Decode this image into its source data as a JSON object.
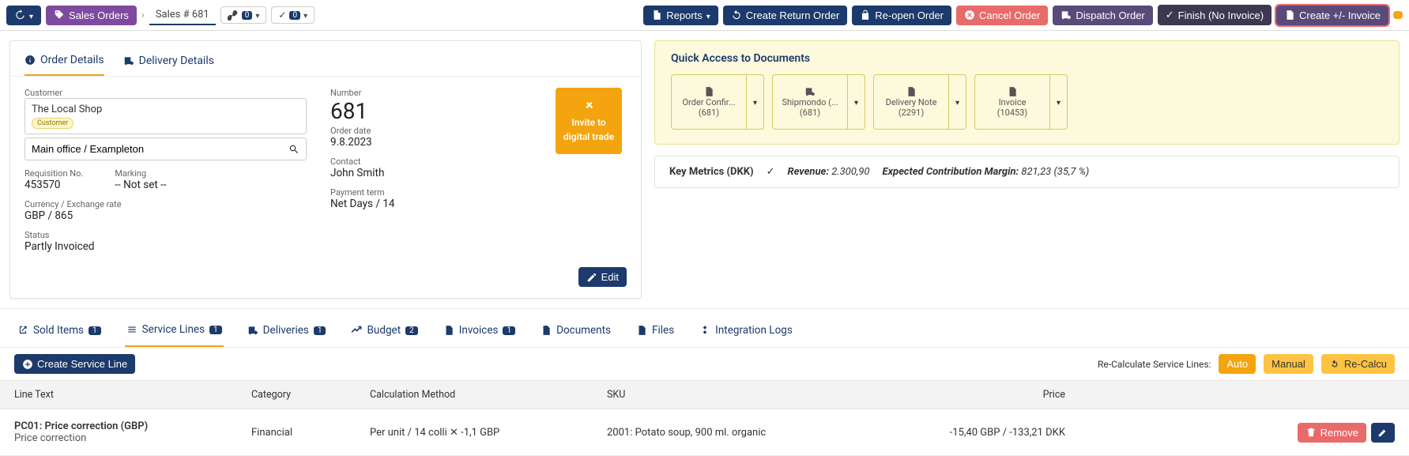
{
  "toolbar": {
    "sales_orders": "Sales Orders",
    "breadcrumb": "Sales # 681",
    "link_count": "0",
    "check_count": "0",
    "reports": "Reports",
    "create_return": "Create Return Order",
    "reopen": "Re-open Order",
    "cancel": "Cancel Order",
    "dispatch": "Dispatch Order",
    "finish": "Finish (No Invoice)",
    "create_invoice": "Create +/- Invoice"
  },
  "card": {
    "tab_order": "Order Details",
    "tab_delivery": "Delivery Details",
    "customer_label": "Customer",
    "customer_name": "The Local Shop",
    "customer_badge": "Customer",
    "location": "Main office / Exampleton",
    "req_label": "Requisition No.",
    "req_value": "453570",
    "marking_label": "Marking",
    "marking_value": "-- Not set --",
    "currency_label": "Currency / Exchange rate",
    "currency_value": "GBP / 865",
    "status_label": "Status",
    "status_value": "Partly Invoiced",
    "number_label": "Number",
    "number_value": "681",
    "orderdate_label": "Order date",
    "orderdate_value": "9.8.2023",
    "contact_label": "Contact",
    "contact_value": "John Smith",
    "payment_label": "Payment term",
    "payment_value": "Net Days / 14",
    "invite_line1": "Invite to",
    "invite_line2": "digital trade",
    "edit": "Edit"
  },
  "quick": {
    "title": "Quick Access to Documents",
    "cards": [
      {
        "label": "Order Confir...",
        "id": "(681)"
      },
      {
        "label": "Shipmondo (...",
        "id": "(681)"
      },
      {
        "label": "Delivery Note",
        "id": "(2291)"
      },
      {
        "label": "Invoice",
        "id": "(10453)"
      }
    ]
  },
  "metrics": {
    "title": "Key Metrics (DKK)",
    "rev_label": "Revenue:",
    "rev_value": "2.300,90",
    "margin_label": "Expected Contribution Margin:",
    "margin_value": "821,23 (35,7 %)"
  },
  "ltabs": {
    "sold": "Sold Items",
    "sold_n": "1",
    "service": "Service Lines",
    "service_n": "1",
    "deliveries": "Deliveries",
    "deliveries_n": "1",
    "budget": "Budget",
    "budget_n": "2",
    "invoices": "Invoices",
    "invoices_n": "1",
    "documents": "Documents",
    "files": "Files",
    "integration": "Integration Logs"
  },
  "actions": {
    "create_line": "Create Service Line",
    "recalc_label": "Re-Calculate Service Lines:",
    "auto": "Auto",
    "manual": "Manual",
    "recalc": "Re-Calcu"
  },
  "table": {
    "h_line": "Line Text",
    "h_cat": "Category",
    "h_calc": "Calculation Method",
    "h_sku": "SKU",
    "h_price": "Price",
    "row": {
      "title": "PC01: Price correction (GBP)",
      "sub": "Price correction",
      "cat": "Financial",
      "calc": "Per unit / 14 colli ✕ -1,1 GBP",
      "sku": "2001: Potato soup, 900 ml. organic",
      "price": "-15,40 GBP / -133,21 DKK",
      "remove": "Remove"
    }
  }
}
